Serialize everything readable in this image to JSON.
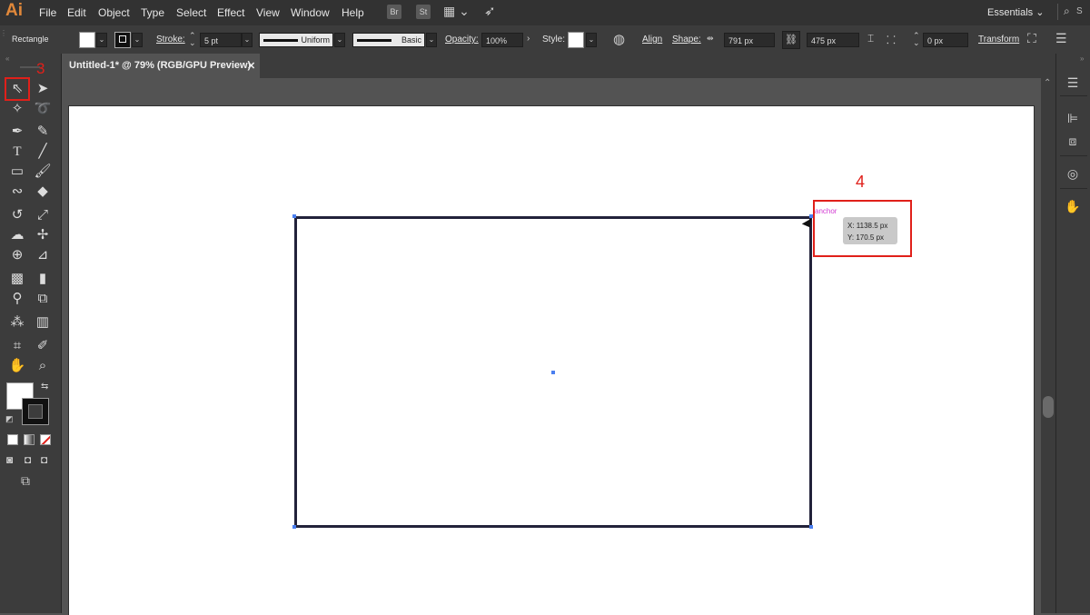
{
  "app": {
    "logo": "Ai"
  },
  "menu": [
    "File",
    "Edit",
    "Object",
    "Type",
    "Select",
    "Effect",
    "View",
    "Window",
    "Help"
  ],
  "menu_buttons": [
    "Br",
    "St"
  ],
  "workspace": {
    "label": "Essentials",
    "search_placeholder": "S"
  },
  "control_bar": {
    "object_type": "Rectangle",
    "stroke_label": "Stroke:",
    "stroke_weight": "5 pt",
    "profile": "Uniform",
    "brush": "Basic",
    "opacity_label": "Opacity:",
    "opacity_value": "100%",
    "style_label": "Style:",
    "align_label": "Align",
    "shape_label": "Shape:",
    "width_value": "791 px",
    "height_value": "475 px",
    "corner_value": "0 px",
    "transform_label": "Transform"
  },
  "document_tab": {
    "title": "Untitled-1* @ 79% (RGB/GPU Preview)",
    "close": "✕"
  },
  "canvas": {
    "anchor_label": "anchor",
    "tooltip_x": "X: 1138.5 px",
    "tooltip_y": "Y: 170.5 px"
  },
  "annotations": {
    "step3": "3",
    "step4": "4"
  },
  "colors": {
    "annotation": "#e0201a",
    "anchor": "#d23bd2",
    "selection": "#4a7ff0"
  },
  "icons": {
    "tools": [
      "selection-tool-icon",
      "direct-selection-tool-icon",
      "magic-wand-icon",
      "lasso-icon",
      "pen-tool-icon",
      "curvature-tool-icon",
      "type-tool-icon",
      "line-tool-icon",
      "rectangle-tool-icon",
      "paintbrush-icon",
      "shaper-tool-icon",
      "eraser-icon",
      "rotate-tool-icon",
      "scale-tool-icon",
      "warp-tool-icon",
      "puppet-warp-icon",
      "shape-builder-icon",
      "perspective-grid-icon",
      "mesh-tool-icon",
      "gradient-tool-icon",
      "eyedropper-icon",
      "blend-tool-icon",
      "symbol-sprayer-icon",
      "column-graph-icon",
      "artboard-tool-icon",
      "slice-tool-icon",
      "hand-tool-icon",
      "zoom-tool-icon"
    ]
  }
}
